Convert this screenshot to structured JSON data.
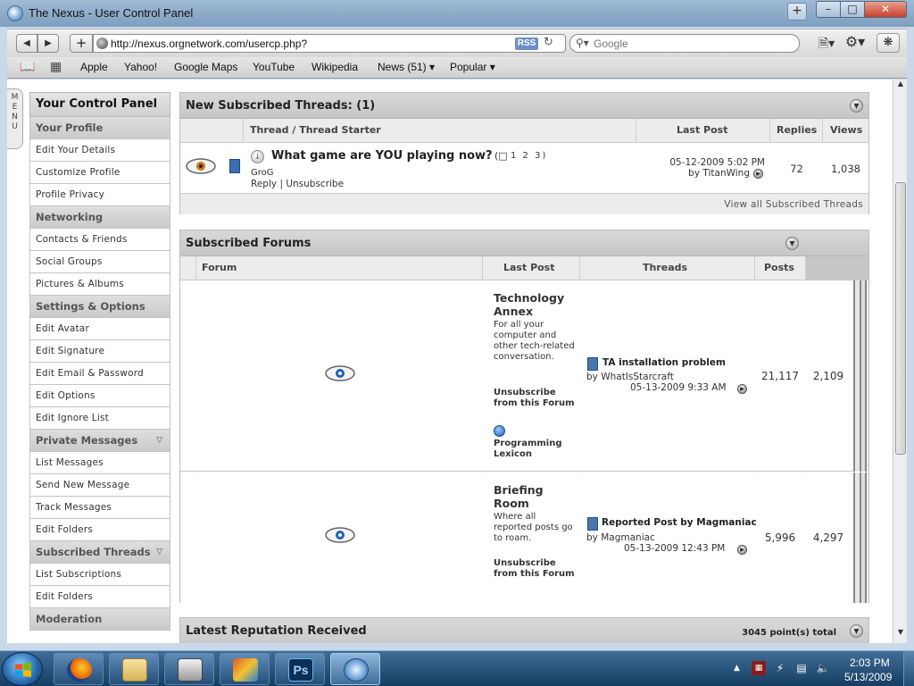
{
  "window": {
    "title": "The Nexus - User Control Panel"
  },
  "toolbar": {
    "url": "http://nexus.orgnetwork.com/usercp.php?",
    "rss_label": "RSS",
    "search_placeholder": "Google"
  },
  "bookmarks": [
    {
      "label": "Apple"
    },
    {
      "label": "Yahoo!"
    },
    {
      "label": "Google Maps"
    },
    {
      "label": "YouTube"
    },
    {
      "label": "Wikipedia"
    },
    {
      "label": "News (51) ▾"
    },
    {
      "label": "Popular ▾"
    }
  ],
  "menu_tab": "M E N U",
  "sidebar": {
    "title": "Your Control Panel",
    "sections": [
      {
        "heading": "Your Profile",
        "items": [
          "Edit Your Details",
          "Customize Profile",
          "Profile Privacy"
        ]
      },
      {
        "heading": "Networking",
        "items": [
          "Contacts & Friends",
          "Social Groups",
          "Pictures & Albums"
        ]
      },
      {
        "heading": "Settings & Options",
        "items": [
          "Edit Avatar",
          "Edit Signature",
          "Edit Email & Password",
          "Edit Options",
          "Edit Ignore List"
        ]
      },
      {
        "heading": "Private Messages",
        "items": [
          "List Messages",
          "Send New Message",
          "Track Messages",
          "Edit Folders"
        ]
      },
      {
        "heading": "Subscribed Threads",
        "items": [
          "List Subscriptions",
          "Edit Folders"
        ]
      },
      {
        "heading": "Moderation",
        "items": []
      }
    ]
  },
  "threads_panel": {
    "title": "New Subscribed Threads: (1)",
    "columns": {
      "thread": "Thread / Thread Starter",
      "last_post": "Last Post",
      "replies": "Replies",
      "views": "Views"
    },
    "thread": {
      "title": "What game are YOU playing now?",
      "pages": "1 2 3",
      "starter": "GroG",
      "reply": "Reply",
      "separator": "|",
      "unsubscribe": "Unsubscribe",
      "last_post_date": "05-12-2009 5:02 PM",
      "last_post_by": "by TitanWing",
      "replies": "72",
      "views": "1,038"
    },
    "view_all": "View all Subscribed Threads"
  },
  "forums_panel": {
    "title": "Subscribed Forums",
    "columns": {
      "forum": "Forum",
      "last_post": "Last Post",
      "threads": "Threads",
      "posts": "Posts"
    },
    "forums": [
      {
        "name": "Technology Annex",
        "description": "For all your computer and other tech-related conversation.",
        "unsubscribe": "Unsubscribe from this Forum",
        "subforum": "Programming Lexicon",
        "last_post_title": "TA installation problem",
        "last_post_by": "by WhatIsStarcraft",
        "last_post_date": "05-13-2009 9:33 AM",
        "threads": "21,117",
        "posts": "2,109"
      },
      {
        "name": "Briefing Room",
        "description": "Where all reported posts go to roam.",
        "unsubscribe": "Unsubscribe from this Forum",
        "last_post_title": "Reported Post by Magmaniac",
        "last_post_by": "by Magmaniac",
        "last_post_date": "05-13-2009 12:43 PM",
        "threads": "5,996",
        "posts": "4,297"
      }
    ]
  },
  "reputation_panel": {
    "title": "Latest Reputation Received",
    "total": "3045 point(s) total"
  },
  "taskbar": {
    "time": "2:03 PM",
    "date": "5/13/2009"
  }
}
